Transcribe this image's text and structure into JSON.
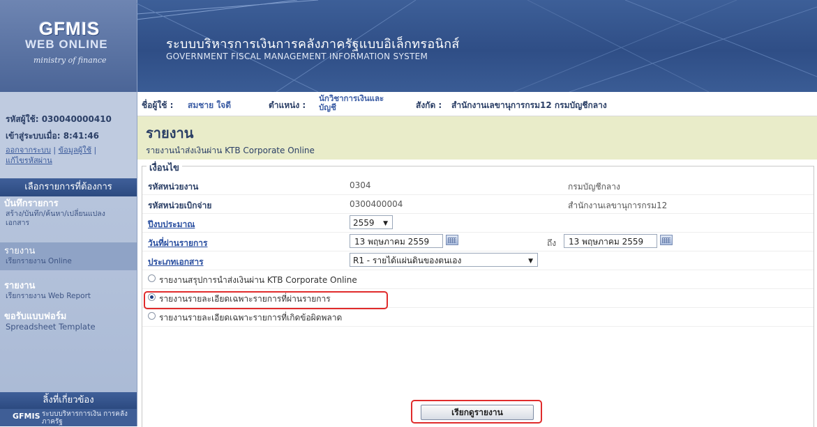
{
  "header": {
    "logo_line1": "GFMIS",
    "logo_line2": "WEB ONLINE",
    "logo_line3": "ministry of finance",
    "title_thai": "ระบบบริหารการเงินการคลังภาครัฐแบบอิเล็กทรอนิกส์",
    "title_eng": "GOVERNMENT FISCAL MANAGEMENT INFORMATION SYSTEM"
  },
  "sidebar": {
    "user_code": "รหัสผู้ใช้: 030040000410",
    "login_time": "เข้าสู่ระบบเมื่อ: 8:41:46",
    "link_logout": "ออกจากระบบ",
    "link_userinfo": "ข้อมูลผู้ใช้",
    "link_changepw": "แก้ไขรหัสผ่าน",
    "select_header": "เลือกรายการที่ต้องการ",
    "items": [
      {
        "title": "บันทึกรายการ",
        "subtitle": "สร้าง/บันทึก/ค้นหา/เปลี่ยนแปลง เอกสาร"
      },
      {
        "title": "รายงาน",
        "subtitle": "เรียกรายงาน Online"
      },
      {
        "title": "รายงาน",
        "subtitle": "เรียกรายงาน Web Report"
      },
      {
        "title": "ขอรับแบบฟอร์ม",
        "subtitle": "Spreadsheet Template"
      }
    ],
    "links_header": "ลิ้งที่เกี่ยวข้อง",
    "bottom_logo_text": "GFMIS",
    "bottom_logo_caption": "ระบบบริหารการเงิน การคลังภาครัฐ"
  },
  "userbar": {
    "user_label": "ชื่อผู้ใช้ :",
    "user_value": "สมชาย ใจดี",
    "position_label": "ตำแหน่ง :",
    "position_value": "นักวิชาการเงินและบัญชี",
    "dept_label": "สังกัด :",
    "dept_value": "สำนักงานเลขานุการกรม12 กรมบัญชีกลาง"
  },
  "page": {
    "title": "รายงาน",
    "subtitle": "รายงานนำส่งเงินผ่าน KTB Corporate Online"
  },
  "form": {
    "legend": "เงื่อนไข",
    "unit_code_label": "รหัสหน่วยงาน",
    "unit_code_value": "0304",
    "unit_code_name": "กรมบัญชีกลาง",
    "disb_code_label": "รหัสหน่วยเบิกจ่าย",
    "disb_code_value": "0300400004",
    "disb_code_name": "สำนักงานเลขานุการกรม12",
    "fiscal_year_label": "ปีงบประมาณ",
    "fiscal_year_value": "2559",
    "date_label": "วันที่ผ่านรายการ",
    "date_from": "13 พฤษภาคม 2559",
    "to_label": "ถึง",
    "date_to": "13 พฤษภาคม 2559",
    "doc_type_label": "ประเภทเอกสาร",
    "doc_type_value": "R1 - รายได้แผ่นดินของตนเอง",
    "radio_options": [
      {
        "label": "รายงานสรุปการนำส่งเงินผ่าน KTB Corporate Online",
        "selected": false
      },
      {
        "label": "รายงานรายละเอียดเฉพาะรายการที่ผ่านรายการ",
        "selected": true
      },
      {
        "label": "รายงานรายละเอียดเฉพาะรายการที่เกิดข้อผิดพลาด",
        "selected": false
      }
    ],
    "submit_label": "เรียกดูรายงาน"
  },
  "colors": {
    "header_bg": "#2f4e86",
    "title_band": "#e9ecc9",
    "highlight": "#e02b2b",
    "link": "#2a4fa0"
  }
}
